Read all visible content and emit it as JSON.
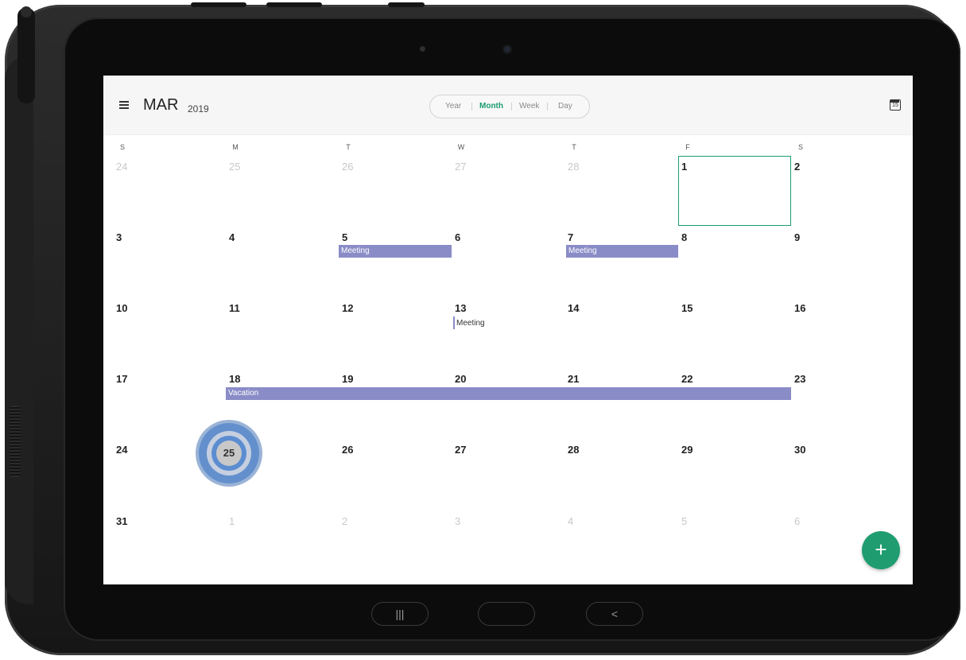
{
  "header": {
    "month": "MAR",
    "year": "2019",
    "menu_icon": "hamburger-menu-icon",
    "today_icon": "calendar-today-icon",
    "today_icon_number": "15"
  },
  "view_switch": {
    "options": [
      "Year",
      "Month",
      "Week",
      "Day"
    ],
    "selected": "Month"
  },
  "weekdays": [
    "S",
    "M",
    "T",
    "W",
    "T",
    "F",
    "S"
  ],
  "weeks": [
    [
      "24",
      "25",
      "26",
      "27",
      "28",
      "1",
      "2"
    ],
    [
      "3",
      "4",
      "5",
      "6",
      "7",
      "8",
      "9"
    ],
    [
      "10",
      "11",
      "12",
      "13",
      "14",
      "15",
      "16"
    ],
    [
      "17",
      "18",
      "19",
      "20",
      "21",
      "22",
      "23"
    ],
    [
      "24",
      "25",
      "26",
      "27",
      "28",
      "29",
      "30"
    ],
    [
      "31",
      "1",
      "2",
      "3",
      "4",
      "5",
      "6"
    ]
  ],
  "events": {
    "meeting_5": "Meeting",
    "meeting_7": "Meeting",
    "meeting_13": "Meeting",
    "vacation": "Vacation"
  },
  "fab": {
    "label": "+",
    "icon": "add-icon"
  },
  "nav_keys": {
    "recents": "|||",
    "home": "",
    "back": "<"
  },
  "colors": {
    "accent": "#1a9c72",
    "event": "#8a8cc7",
    "touch": "#5b8dd0"
  }
}
